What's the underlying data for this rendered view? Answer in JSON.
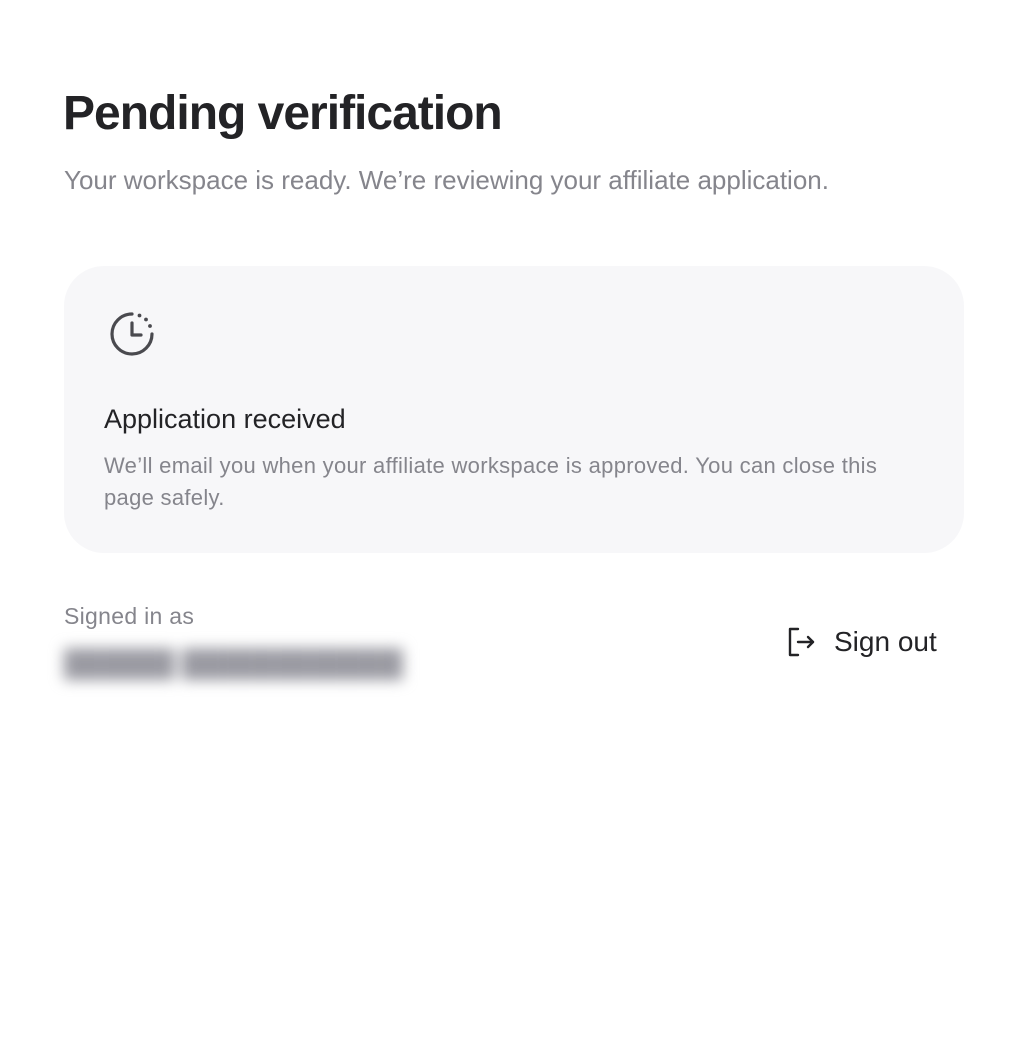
{
  "header": {
    "title": "Pending verification",
    "subtitle": "Your workspace is ready. We’re reviewing your affiliate application."
  },
  "status_card": {
    "icon": "clock-pending-icon",
    "heading": "Application received",
    "body": "We’ll email you when your affiliate workspace is approved. You can close this page safely."
  },
  "account": {
    "signed_in_label": "Signed in as",
    "email": "██████ ████████████"
  },
  "actions": {
    "sign_out_label": "Sign out",
    "sign_out_icon": "sign-out-icon"
  },
  "colors": {
    "heading": "#232326",
    "muted": "#85858c",
    "card_background": "#f7f7f9"
  }
}
